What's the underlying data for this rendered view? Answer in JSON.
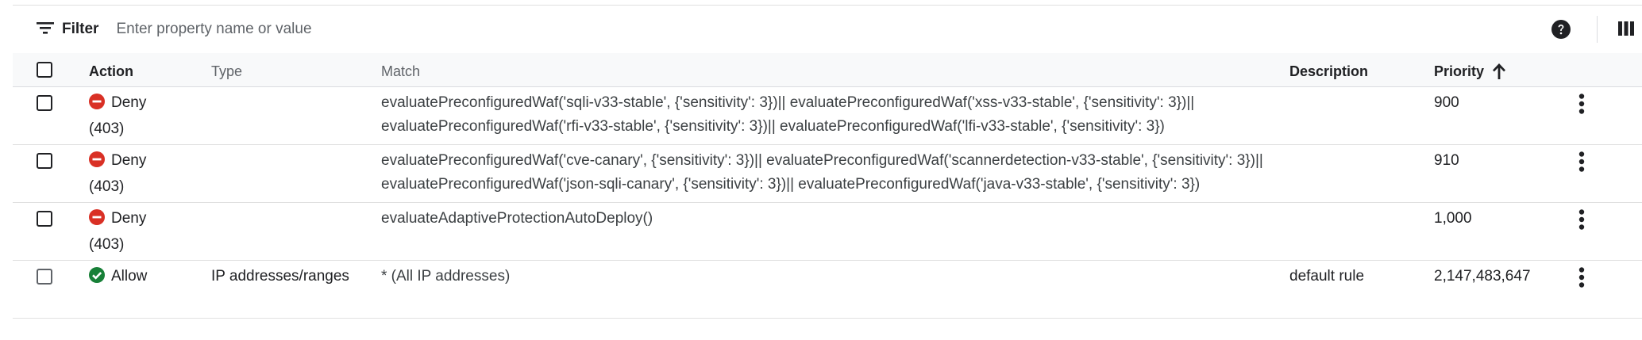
{
  "filter": {
    "label": "Filter",
    "placeholder": "Enter property name or value"
  },
  "toolbar": {
    "help_icon": "help-icon",
    "columns_icon": "column-display-icon"
  },
  "columns": {
    "action": "Action",
    "type": "Type",
    "match": "Match",
    "description": "Description",
    "priority": "Priority",
    "priority_sort": "ascending"
  },
  "colors": {
    "deny": "#d93025",
    "allow": "#188038"
  },
  "rules": [
    {
      "action": "Deny",
      "action_code": "(403)",
      "action_icon": "deny-icon",
      "type": "",
      "match": "evaluatePreconfiguredWaf('sqli-v33-stable', {'sensitivity': 3})|| evaluatePreconfiguredWaf('xss-v33-stable', {'sensitivity': 3})|| evaluatePreconfiguredWaf('rfi-v33-stable', {'sensitivity': 3})|| evaluatePreconfiguredWaf('lfi-v33-stable', {'sensitivity': 3})",
      "description": "",
      "priority": "900"
    },
    {
      "action": "Deny",
      "action_code": "(403)",
      "action_icon": "deny-icon",
      "type": "",
      "match": "evaluatePreconfiguredWaf('cve-canary', {'sensitivity': 3})|| evaluatePreconfiguredWaf('scannerdetection-v33-stable', {'sensitivity': 3})|| evaluatePreconfiguredWaf('json-sqli-canary', {'sensitivity': 3})|| evaluatePreconfiguredWaf('java-v33-stable', {'sensitivity': 3})",
      "description": "",
      "priority": "910"
    },
    {
      "action": "Deny",
      "action_code": "(403)",
      "action_icon": "deny-icon",
      "type": "",
      "match": "evaluateAdaptiveProtectionAutoDeploy()",
      "description": "",
      "priority": "1,000"
    },
    {
      "action": "Allow",
      "action_code": "",
      "action_icon": "allow-icon",
      "type": "IP addresses/ranges",
      "match": "* (All IP addresses)",
      "description": "default rule",
      "priority": "2,147,483,647"
    }
  ]
}
